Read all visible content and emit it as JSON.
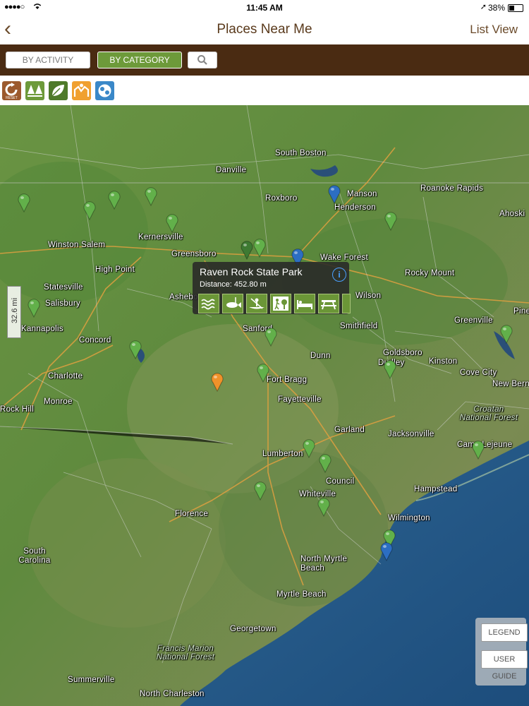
{
  "status": {
    "time": "11:45 AM",
    "battery": "38%"
  },
  "nav": {
    "title": "Places Near Me",
    "list_view": "List View"
  },
  "filters": {
    "by_activity": "BY ACTIVITY",
    "by_category": "BY CATEGORY"
  },
  "categories": [
    {
      "icon": "reset-icon",
      "label": "RESET",
      "color": "#a0522d"
    },
    {
      "icon": "trees-icon",
      "color": "#6d9a3a"
    },
    {
      "icon": "leaf-icon",
      "color": "#4e7a2a"
    },
    {
      "icon": "hands-icon",
      "color": "#f0a030"
    },
    {
      "icon": "globe-icon",
      "color": "#3a88c8"
    }
  ],
  "map": {
    "scale_label": "32.6 mi",
    "cities": [
      "South Boston",
      "Danville",
      "Manson",
      "Roanoke Rapids",
      "Roxboro",
      "Henderson",
      "Ahoski",
      "Winston Salem",
      "Kernersville",
      "Greensboro",
      "Wake Forest",
      "High Point",
      "Rocky Mount",
      "Statesville",
      "Asheboro",
      "Wilson",
      "Salisbury",
      "Pine",
      "Kannapolis",
      "Sanford",
      "Smithfield",
      "Greenville",
      "Concord",
      "Dunn",
      "Goldsboro",
      "Kinston",
      "Charlotte",
      "Dudley",
      "Cove City",
      "New Bern",
      "Monroe",
      "Fort Bragg",
      "Fayetteville",
      "Croatan National Forest",
      "Garland",
      "Jacksonville",
      "Camp Lejeune",
      "Lumberton",
      "Council",
      "Hampstead",
      "Whiteville",
      "Florence",
      "Wilmington",
      "South Carolina",
      "North Myrtle Beach",
      "Myrtle Beach",
      "Georgetown",
      "Francis Marion National Forest",
      "Summerville",
      "North Charleston",
      "Rock Hill"
    ],
    "callout": {
      "name": "Raven Rock State Park",
      "distance": "Distance: 452.80 m"
    },
    "legend": "LEGEND",
    "user_guide": "USER GUIDE"
  }
}
